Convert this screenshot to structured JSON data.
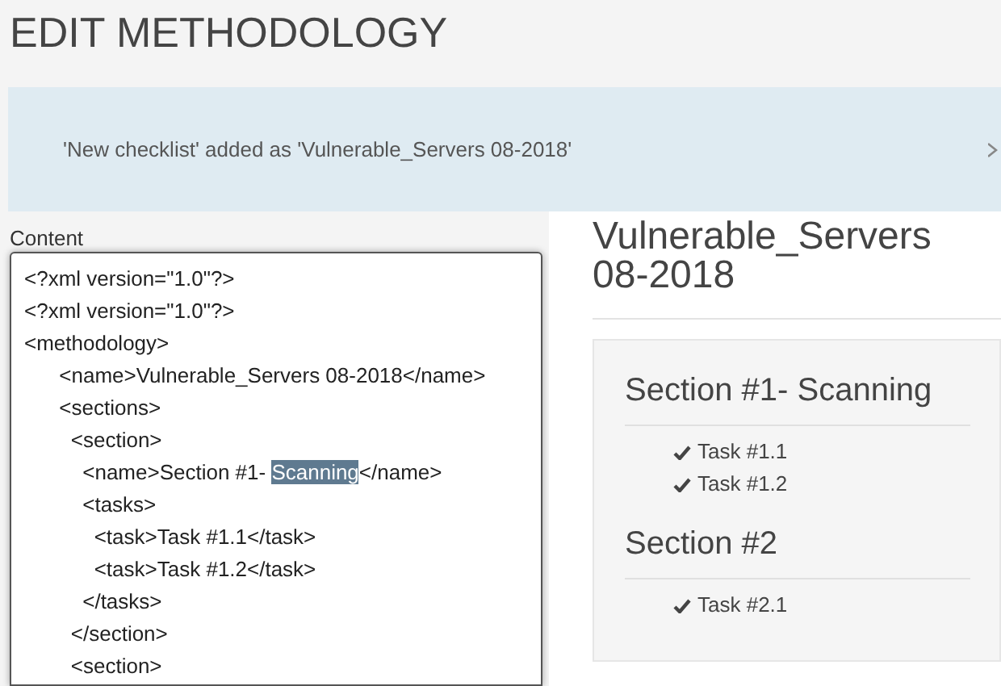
{
  "page_title": "EDIT METHODOLOGY",
  "alert": {
    "message": "'New checklist' added as 'Vulnerable_Servers 08-2018'"
  },
  "content_label": "Content",
  "editor_lines": [
    [
      {
        "text": "<?xml version=\"1.0\"?>",
        "selected": false
      }
    ],
    [
      {
        "text": "<?xml version=\"1.0\"?>",
        "selected": false
      }
    ],
    [
      {
        "text": "<methodology>",
        "selected": false
      }
    ],
    [
      {
        "text": "      <name>Vulnerable_Servers 08-2018</name>",
        "selected": false
      }
    ],
    [
      {
        "text": "      <sections>",
        "selected": false
      }
    ],
    [
      {
        "text": "        <section>",
        "selected": false
      }
    ],
    [
      {
        "text": "          <name>Section #1- ",
        "selected": false
      },
      {
        "text": "Scanning",
        "selected": true
      },
      {
        "text": "</name>",
        "selected": false
      }
    ],
    [
      {
        "text": "          <tasks>",
        "selected": false
      }
    ],
    [
      {
        "text": "            <task>Task #1.1</task>",
        "selected": false
      }
    ],
    [
      {
        "text": "            <task>Task #1.2</task>",
        "selected": false
      }
    ],
    [
      {
        "text": "          </tasks>",
        "selected": false
      }
    ],
    [
      {
        "text": "        </section>",
        "selected": false
      }
    ],
    [
      {
        "text": "        <section>",
        "selected": false
      }
    ]
  ],
  "preview": {
    "title": "Vulnerable_Servers 08-2018",
    "sections": [
      {
        "name": "Section #1- Scanning",
        "tasks": [
          "Task #1.1",
          "Task #1.2"
        ]
      },
      {
        "name": "Section #2",
        "tasks": [
          "Task #2.1"
        ]
      }
    ]
  }
}
